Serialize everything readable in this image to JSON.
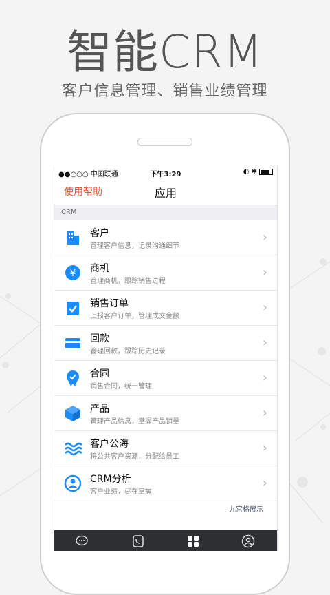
{
  "headline": "智能CRM",
  "subline": "客户信息管理、销售业绩管理",
  "status": {
    "carrier": "●●○○○ 中国联通",
    "time": "下午3:29"
  },
  "nav": {
    "left": "使用帮助",
    "title": "应用"
  },
  "section_label": "CRM",
  "items": [
    {
      "title": "客户",
      "desc": "管理客户信息，记录沟通细节",
      "icon": "building-icon"
    },
    {
      "title": "商机",
      "desc": "管理商机，跟踪销售过程",
      "icon": "yuan-icon"
    },
    {
      "title": "销售订单",
      "desc": "上报客户订单，管理成交金额",
      "icon": "clipboard-check-icon"
    },
    {
      "title": "回款",
      "desc": "管理回款，跟踪历史记录",
      "icon": "card-icon"
    },
    {
      "title": "合同",
      "desc": "销售合同，统一管理",
      "icon": "certificate-icon"
    },
    {
      "title": "产品",
      "desc": "管理产品信息，掌握产品销量",
      "icon": "box-icon"
    },
    {
      "title": "客户公海",
      "desc": "将公共客户资源，分配给员工",
      "icon": "waves-icon"
    },
    {
      "title": "CRM分析",
      "desc": "客户业绩，尽在掌握",
      "icon": "analysis-icon"
    }
  ],
  "grid_link": "九宫格展示",
  "accent": "#1a8cff",
  "link_color": "#e25b3a"
}
